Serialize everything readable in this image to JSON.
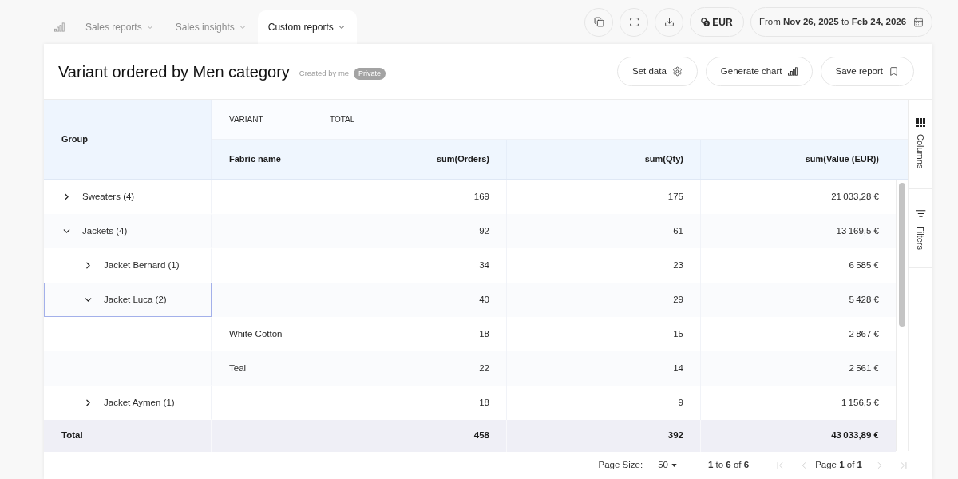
{
  "nav": {
    "tabs": [
      {
        "label": "Sales reports",
        "selected": false
      },
      {
        "label": "Sales insights",
        "selected": false
      },
      {
        "label": "Custom reports",
        "selected": true
      }
    ]
  },
  "toolbar": {
    "currency": "EUR",
    "date_range": "From **Nov 26, 2025** to **Feb 24, 2026**"
  },
  "report": {
    "title": "Variant ordered by Men category",
    "created_by": "Created by me",
    "visibility": "Private",
    "actions": [
      {
        "kind": "settings",
        "label": "Set data"
      },
      {
        "kind": "chart",
        "label": "Generate chart"
      },
      {
        "kind": "bookmark",
        "label": "Save report"
      }
    ]
  },
  "table": {
    "group_header": "Group",
    "column_groups": [
      "VARIANT",
      "TOTAL"
    ],
    "columns": [
      "Fabric name",
      "sum(Orders)",
      "sum(Qty)",
      "sum(Value (EUR))"
    ],
    "rows": [
      {
        "kind": "group",
        "group": "Sweaters (4)",
        "expanded": false,
        "selected": false,
        "orders": "169",
        "qty": "175",
        "value": "21 033,28 €"
      },
      {
        "kind": "group",
        "group": "Jackets (4)",
        "expanded": true,
        "selected": false,
        "orders": "92",
        "qty": "61",
        "value": "13 169,5 €",
        "children": [
          {
            "kind": "group",
            "group": "Jacket Bernard (1)",
            "expanded": false,
            "selected": false,
            "orders": "34",
            "qty": "23",
            "value": "6 585 €"
          },
          {
            "kind": "group",
            "group": "Jacket Luca (2)",
            "expanded": true,
            "selected": true,
            "orders": "40",
            "qty": "29",
            "value": "5 428 €",
            "children": [
              {
                "kind": "variant",
                "fabric": "White Cotton",
                "selected": false,
                "orders": "18",
                "qty": "15",
                "value": "2 867 €"
              },
              {
                "kind": "variant",
                "fabric": "Teal",
                "selected": false,
                "orders": "22",
                "qty": "14",
                "value": "2 561 €"
              }
            ]
          },
          {
            "kind": "group",
            "group": "Jacket Aymen (1)",
            "expanded": false,
            "selected": false,
            "orders": "18",
            "qty": "9",
            "value": "1 156,5 €"
          }
        ]
      }
    ],
    "total": {
      "label": "Total",
      "orders": "458",
      "qty": "392",
      "value": "43 033,89 €"
    }
  },
  "side_panel": [
    {
      "kind": "columns",
      "label": "Columns"
    },
    {
      "kind": "filters",
      "label": "Filters"
    }
  ],
  "pagination": {
    "page_size_label": "Page Size:",
    "page_size": "50",
    "range": "**1** to **6** of **6**",
    "page": "Page **1** of **1**",
    "buttons": [
      {
        "kind": "first",
        "disabled": true
      },
      {
        "kind": "previous",
        "disabled": true
      },
      {
        "kind": "next",
        "disabled": true
      },
      {
        "kind": "last",
        "disabled": true
      }
    ]
  }
}
